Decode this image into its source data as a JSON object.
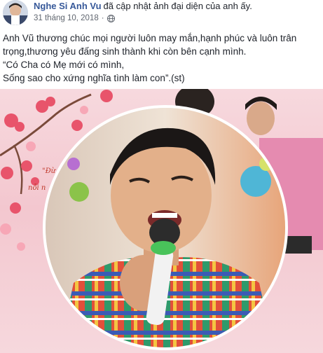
{
  "post": {
    "author": "Nghe Si Anh Vu",
    "action": "đã cập nhật ảnh đại diện của anh ấy.",
    "date": "31 tháng 10, 2018",
    "separator": "·",
    "privacy_icon": "globe-icon",
    "text_lines": [
      "Anh Vũ thương chúc mọi người luôn may mắn,hạnh phúc và luôn trân",
      "trọng,thương yêu đấng sinh thành khi còn bên cạnh mình.",
      "“Có Cha có Mẹ mới có mình,",
      "Sống sao cho xứng nghĩa tình làm con”.(st)"
    ]
  },
  "photo": {
    "background_texts": [
      "\"Đừ",
      "nỗi n"
    ]
  },
  "colors": {
    "link": "#365899",
    "meta": "#616770",
    "text": "#1d2129",
    "background_pink": "#f3c7cf"
  }
}
